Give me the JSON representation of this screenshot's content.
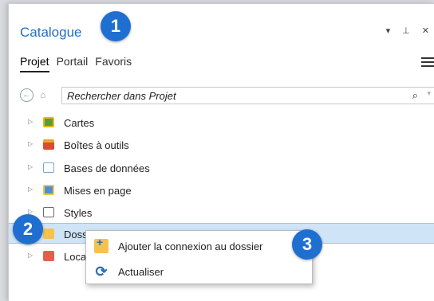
{
  "pane": {
    "title": "Catalogue",
    "controls": "▾ ⊥ ✕"
  },
  "tabs": [
    {
      "label": "Projet",
      "active": true
    },
    {
      "label": "Portail",
      "active": false
    },
    {
      "label": "Favoris",
      "active": false
    }
  ],
  "search": {
    "placeholder": "Rechercher dans Projet",
    "glass": "⌕",
    "drop": "▾"
  },
  "tree": {
    "items": [
      {
        "label": "Cartes",
        "icon": "maps-icon"
      },
      {
        "label": "Boîtes à outils",
        "icon": "toolbox-icon"
      },
      {
        "label": "Bases de données",
        "icon": "database-icon"
      },
      {
        "label": "Mises en page",
        "icon": "layout-icon"
      },
      {
        "label": "Styles",
        "icon": "styles-icon"
      },
      {
        "label": "Dossiers",
        "icon": "folder-icon",
        "selected": true
      },
      {
        "label": "Localisateurs",
        "icon": "locators-icon"
      }
    ]
  },
  "context_menu": {
    "items": [
      {
        "label": "Ajouter la connexion au dossier",
        "icon": "add-folder-connection-icon"
      },
      {
        "label": "Actualiser",
        "icon": "refresh-icon"
      }
    ]
  },
  "callouts": [
    "1",
    "2",
    "3"
  ],
  "colors": {
    "accent": "#1e6fc7",
    "badge": "#1f6fd1",
    "selection": "#cfe4f7"
  }
}
